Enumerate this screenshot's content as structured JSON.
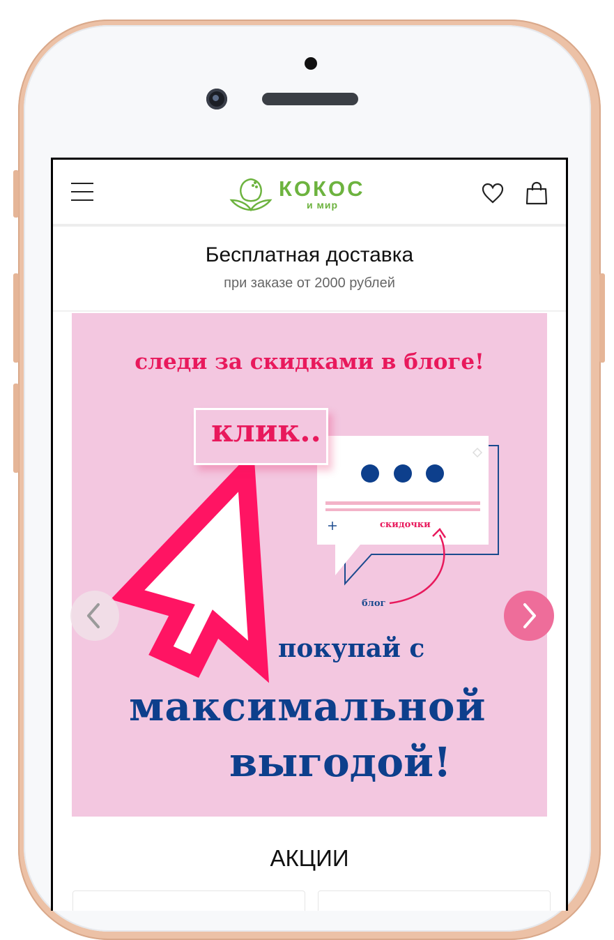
{
  "header": {
    "logo_main": "КОКОС",
    "logo_sub": "и мир"
  },
  "promo": {
    "title": "Бесплатная доставка",
    "subtitle": "при заказе от 2000 рублей"
  },
  "banner": {
    "headline": "следи за скидками в блоге!",
    "click_text": "клик..",
    "discount_label": "скидочки",
    "blog_label": "блог",
    "line1": "покупай с",
    "line2": "максимальной",
    "line3": "выгодой!"
  },
  "sections": {
    "promotions_title": "АКЦИИ"
  },
  "colors": {
    "brand_green": "#6db33f",
    "banner_bg": "#f3c7e0",
    "accent_pink": "#e8195c",
    "accent_blue": "#0d3f8c",
    "next_button": "#ee6d9a",
    "phone_frame": "#ecc1a6"
  },
  "icons": [
    "hamburger-menu-icon",
    "coconut-logo-icon",
    "heart-icon",
    "shopping-bag-icon",
    "chevron-left-icon",
    "chevron-right-icon"
  ]
}
